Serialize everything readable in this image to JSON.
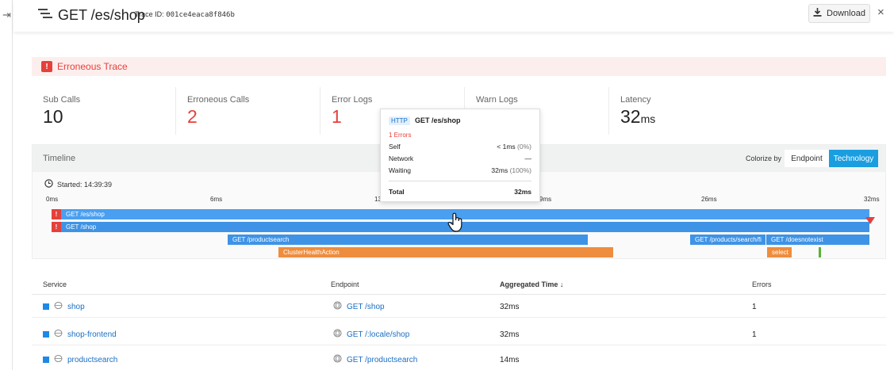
{
  "header": {
    "title": "GET /es/shop",
    "trace_id_label": "Trace ID:",
    "trace_id": "001ce4eaca8f846b",
    "download_label": "Download",
    "close_glyph": "×"
  },
  "error_banner": {
    "icon_glyph": "!",
    "title": "Erroneous Trace",
    "color": "#e5403a"
  },
  "stats": [
    {
      "label": "Sub Calls",
      "value": "10"
    },
    {
      "label": "Erroneous Calls",
      "value": "2"
    },
    {
      "label": "Error Logs",
      "value": "1"
    },
    {
      "label": "Warn Logs",
      "value": ""
    },
    {
      "label": "Latency",
      "value": "32",
      "unit": "ms"
    }
  ],
  "timeline": {
    "title": "Timeline",
    "colorize_label": "Colorize by",
    "options": [
      "Endpoint",
      "Technology"
    ],
    "selected_option": "Technology",
    "started": "Started: 14:39:39",
    "ticks": [
      "0ms",
      "6ms",
      "13",
      "9ms",
      "26ms",
      "32ms"
    ],
    "bars": {
      "b1": "GET /es/shop",
      "b2": "GET /shop",
      "b3": "GET /productsearch",
      "b4": "GET /products/search/fi",
      "b5": "GET /doesnotexist",
      "b6": "ClusterHealthAction",
      "b7": "select"
    },
    "error_glyph": "!"
  },
  "table": {
    "headers": {
      "service": "Service",
      "endpoint": "Endpoint",
      "aggregated_time": "Aggregated Time",
      "sort_glyph": "↓",
      "errors": "Errors"
    },
    "rows": [
      {
        "service": "shop",
        "endpoint": "GET /shop",
        "time": "32ms",
        "errors": "1"
      },
      {
        "service": "shop-frontend",
        "endpoint": "GET /:locale/shop",
        "time": "32ms",
        "errors": "1"
      },
      {
        "service": "productsearch",
        "endpoint": "GET /productsearch",
        "time": "14ms",
        "errors": ""
      }
    ]
  },
  "tooltip": {
    "badge": "HTTP",
    "title": "GET /es/shop",
    "errors": "1 Errors",
    "self_label": "Self",
    "self_value": "< 1ms",
    "self_pct": "(0%)",
    "network_label": "Network",
    "network_value": "—",
    "waiting_label": "Waiting",
    "waiting_value": "32ms",
    "waiting_pct": "(100%)",
    "total_label": "Total",
    "total_value": "32ms"
  },
  "colors": {
    "accent": "#1a9ee0",
    "error": "#e5403a",
    "bar_blue": "#4a9ff0",
    "bar_orange": "#ee8d3e"
  }
}
